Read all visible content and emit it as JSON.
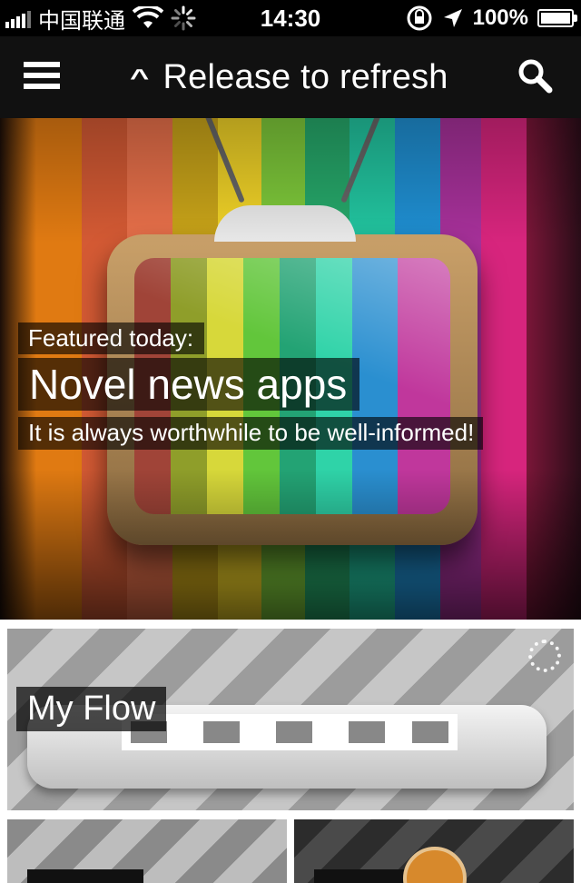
{
  "status_bar": {
    "carrier": "中国联通",
    "time": "14:30",
    "battery_percent": "100%"
  },
  "nav": {
    "refresh_text": "Release to refresh"
  },
  "featured": {
    "label": "Featured today:",
    "title": "Novel news apps",
    "subtitle": "It is always worthwhile to be well-informed!"
  },
  "cards": [
    {
      "label": "My Flow"
    }
  ],
  "colors": {
    "navbar": "#111111",
    "caption_bg": "rgba(0,0,0,0.62)"
  },
  "icons": {
    "menu": "hamburger-icon",
    "refresh": "chevron-up-icon",
    "search": "magnifier-icon"
  }
}
